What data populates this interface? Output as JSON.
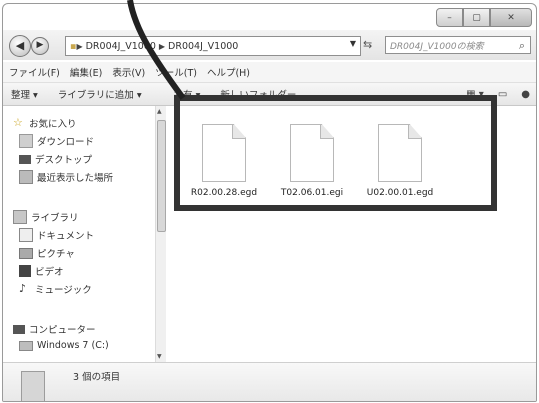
{
  "window": {
    "caption_buttons": [
      "–",
      "▢",
      "✕"
    ]
  },
  "address_bar": {
    "crumbs": [
      "DR004J_V1000",
      "DR004J_V1000"
    ],
    "search_placeholder": "DR004J_V1000の検索"
  },
  "menu": [
    "ファイル(F)",
    "編集(E)",
    "表示(V)",
    "ツール(T)",
    "ヘルプ(H)"
  ],
  "toolbar": {
    "organize": "整理 ▾",
    "add_library": "ライブラリに追加 ▾",
    "share": "共有 ▾",
    "new_folder": "新しいフォルダー"
  },
  "sidebar": {
    "favorites": "お気に入り",
    "downloads": "ダウンロード",
    "desktop": "デスクトップ",
    "recent": "最近表示した場所",
    "libraries": "ライブラリ",
    "documents": "ドキュメント",
    "pictures": "ピクチャ",
    "videos": "ビデオ",
    "music": "ミュージック",
    "computer": "コンピューター",
    "drive": "Windows 7 (C:)"
  },
  "files": [
    {
      "name": "R02.00.28.egd"
    },
    {
      "name": "T02.06.01.egi"
    },
    {
      "name": "U02.00.01.egd"
    }
  ],
  "status": {
    "count": "3 個の項目"
  },
  "colors": {
    "frame": "#333333",
    "toolbar": "#e6e6e6"
  }
}
